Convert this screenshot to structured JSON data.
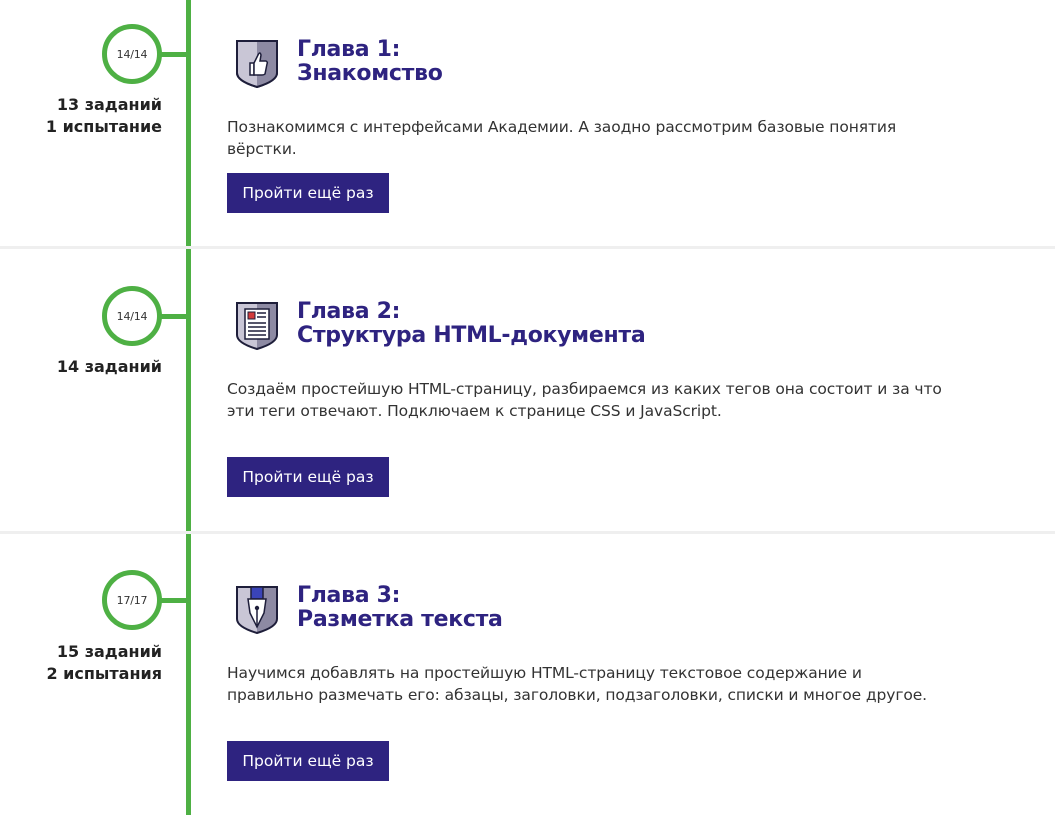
{
  "chapters": [
    {
      "progress": "14/14",
      "meta_line1": "13 заданий",
      "meta_line2": "1 испытание",
      "title_line1": "Глава 1:",
      "title_line2": "Знакомство",
      "description": "Познакомимся с интерфейсами Академии. А заодно рассмотрим базовые понятия вёрстки.",
      "button_label": "Пройти ещё раз",
      "icon": "thumbs-up-icon"
    },
    {
      "progress": "14/14",
      "meta_line1": "14 заданий",
      "meta_line2": "",
      "title_line1": "Глава 2:",
      "title_line2": "Структура HTML-документа",
      "description": "Создаём простейшую HTML-страницу, разбираемся из каких тегов она состоит и за что эти теги отвечают. Подключаем к странице CSS и JavaScript.",
      "button_label": "Пройти ещё раз",
      "icon": "document-icon"
    },
    {
      "progress": "17/17",
      "meta_line1": "15 заданий",
      "meta_line2": "2 испытания",
      "title_line1": "Глава 3:",
      "title_line2": "Разметка текста",
      "description": "Научимся добавлять на простейшую HTML-страницу текстовое содержание и правильно размечать его: абзацы, заголовки, подзаголовки, списки и многое другое.",
      "button_label": "Пройти ещё раз",
      "icon": "pen-nib-icon"
    }
  ],
  "colors": {
    "accent": "#2e2380",
    "timeline": "#4eb044",
    "divider": "#efefef"
  }
}
